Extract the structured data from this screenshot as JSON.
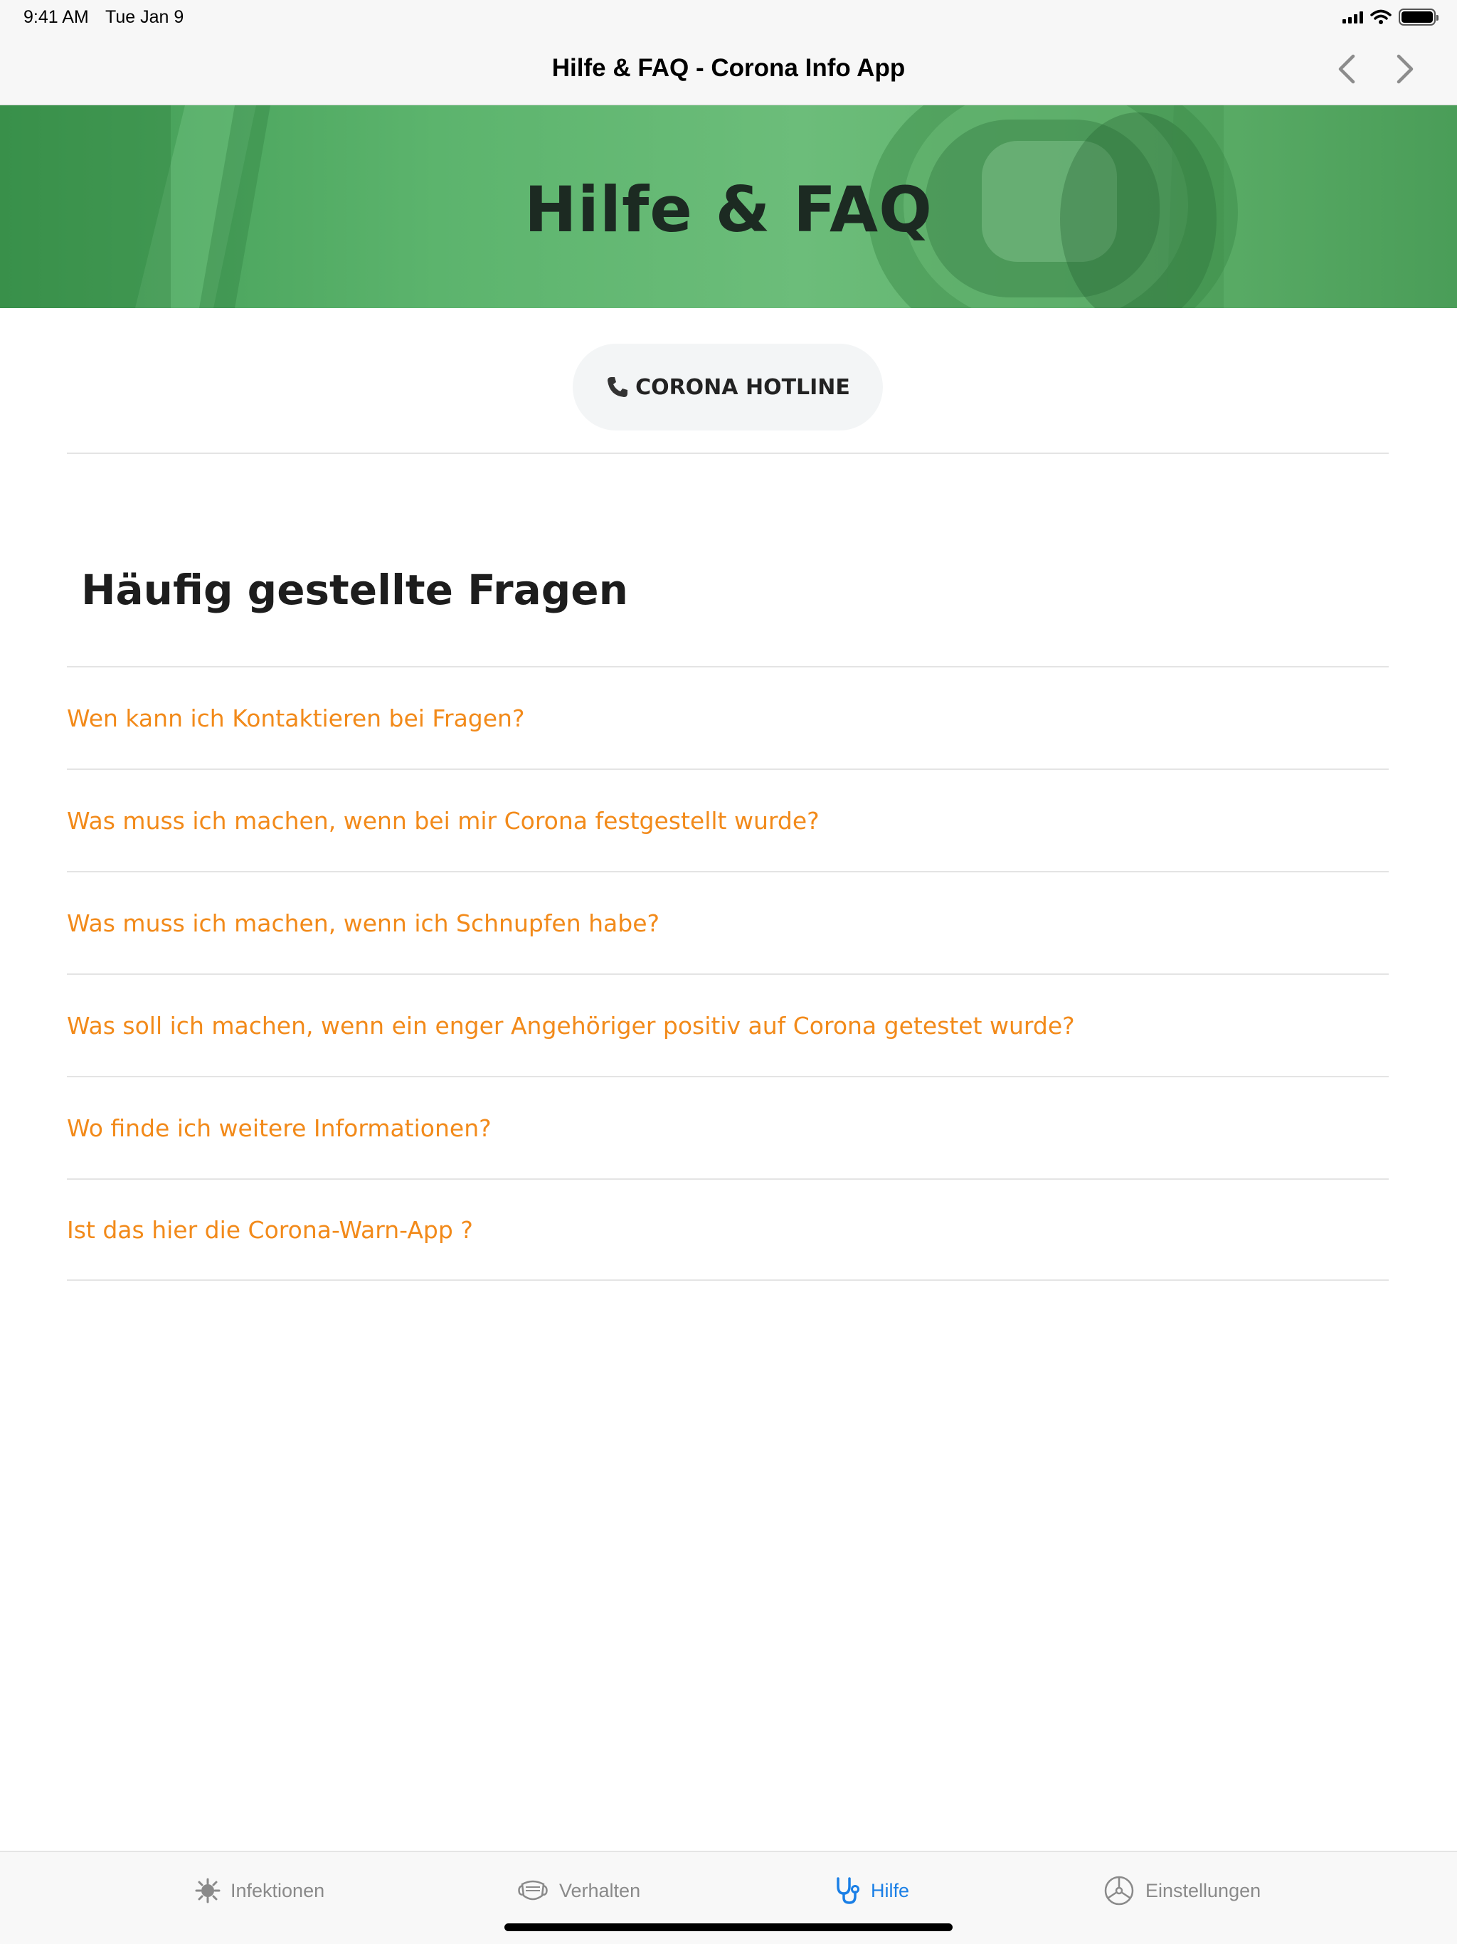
{
  "status_bar": {
    "time": "9:41 AM",
    "date": "Tue Jan 9",
    "icons": [
      "cellular-signal-icon",
      "wifi-icon",
      "battery-icon"
    ]
  },
  "nav": {
    "title": "Hilfe & FAQ - Corona Info App",
    "back_icon": "chevron-left-icon",
    "forward_icon": "chevron-right-icon"
  },
  "hero": {
    "title": "Hilfe & FAQ",
    "color": "#5cb46d"
  },
  "hotline": {
    "icon": "phone-icon",
    "label": "CORONA HOTLINE"
  },
  "faq": {
    "heading": "Häufig gestellte Fragen",
    "link_color": "#f28a1a",
    "items": [
      "Wen kann ich Kontaktieren bei Fragen?",
      "Was muss ich machen, wenn bei mir Corona festgestellt wurde?",
      "Was muss ich machen, wenn ich Schnupfen habe?",
      "Was soll ich machen, wenn ein enger Angehöriger positiv auf Corona getestet wurde?",
      "Wo finde ich weitere Informationen?",
      "Ist das hier die Corona-Warn-App ?"
    ]
  },
  "tab_bar": {
    "active_color": "#1a7fe6",
    "tabs": [
      {
        "label": "Infektionen",
        "icon": "virus-icon",
        "active": false
      },
      {
        "label": "Verhalten",
        "icon": "face-mask-icon",
        "active": false
      },
      {
        "label": "Hilfe",
        "icon": "stethoscope-icon",
        "active": true
      },
      {
        "label": "Einstellungen",
        "icon": "steering-wheel-icon",
        "active": false
      }
    ]
  }
}
